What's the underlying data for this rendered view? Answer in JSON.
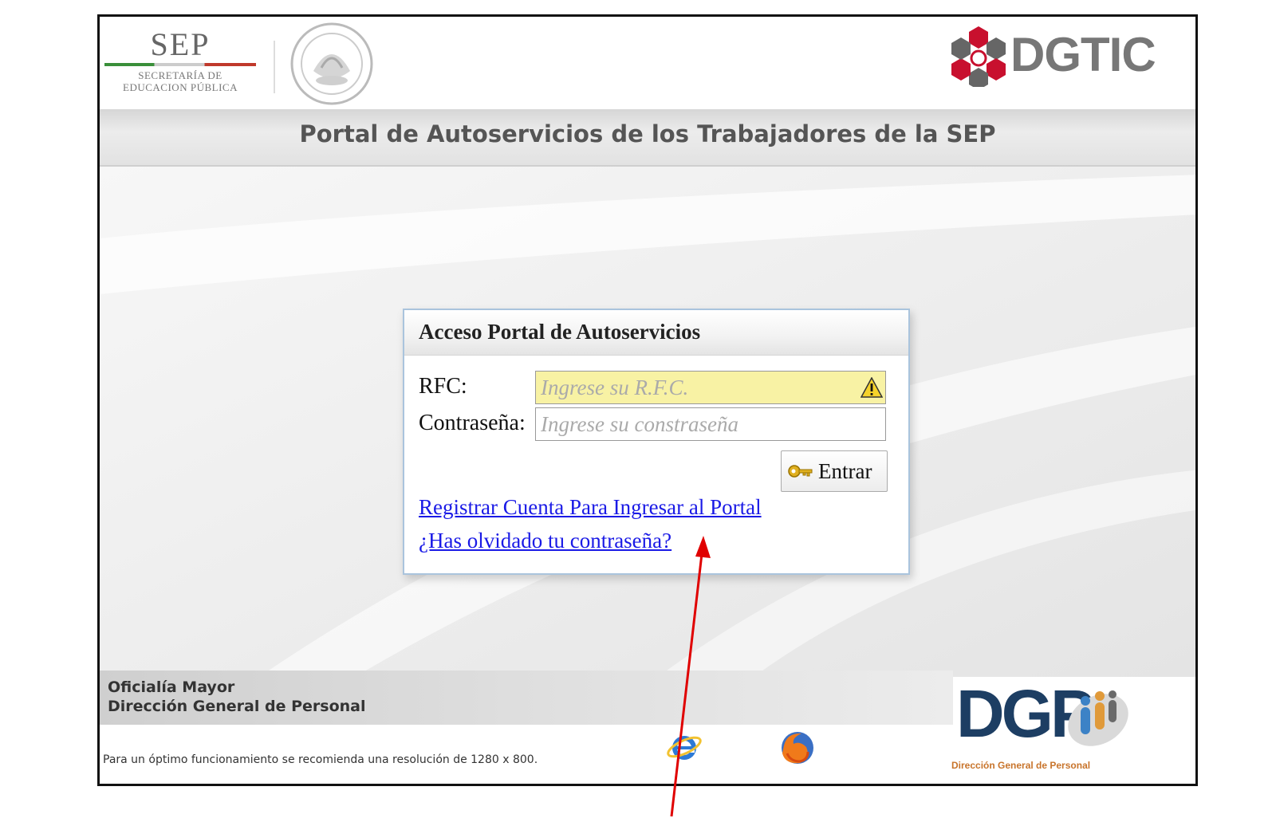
{
  "header": {
    "sep_logo": {
      "word": "SEP",
      "line1": "SECRETARÍA DE",
      "line2": "EDUCACION PÚBLICA"
    },
    "seal_icon": "mexican-national-seal",
    "dgtic_logo": "DGTIC",
    "title": "Portal de Autoservicios de los Trabajadores de la SEP"
  },
  "login": {
    "title": "Acceso Portal de Autoservicios",
    "rfc_label": "RFC:",
    "rfc_placeholder": "Ingrese su R.F.C.",
    "rfc_value": "",
    "password_label": "Contraseña:",
    "password_placeholder": "Ingrese su constraseña",
    "password_value": "",
    "submit_label": "Entrar",
    "register_link": "Registrar Cuenta Para Ingresar al Portal",
    "forgot_link": "¿Has olvidado tu contraseña?"
  },
  "footer": {
    "line1": "Oficialía Mayor",
    "line2": "Dirección General de Personal",
    "recommendation": "Para un óptimo funcionamiento se recomienda una resolución de 1280 x 800.",
    "browser_icons": [
      "internet-explorer-icon",
      "firefox-icon"
    ],
    "dgp_logo": "DGP",
    "dgp_caption": "Dirección General de Personal"
  },
  "colors": {
    "accent_red": "#c8102e",
    "link_blue": "#1a1ae6",
    "rfc_field_bg": "#f8f2a4",
    "dgp_navy": "#1d3e63",
    "annotation_arrow": "#e00000"
  }
}
